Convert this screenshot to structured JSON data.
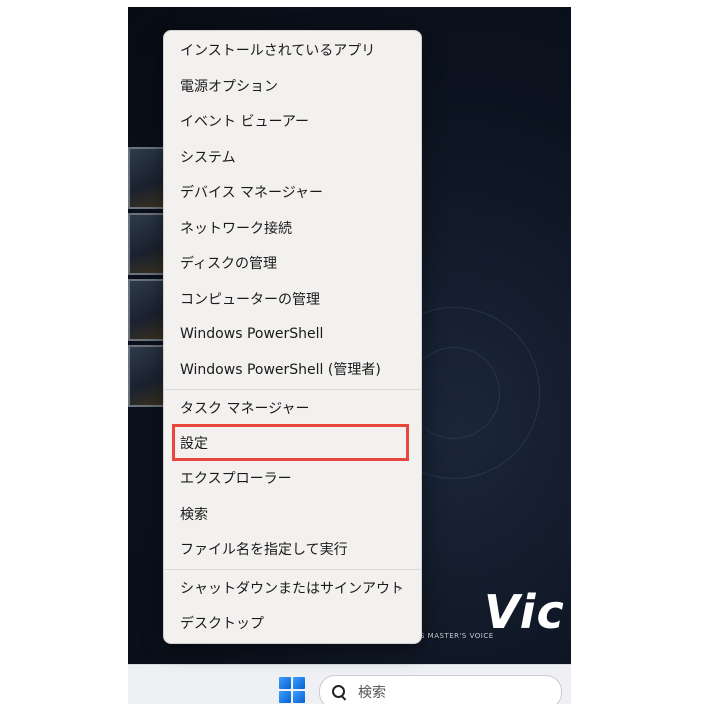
{
  "context_menu": {
    "items": [
      {
        "label": "インストールされているアプリ"
      },
      {
        "label": "電源オプション"
      },
      {
        "label": "イベント ビューアー"
      },
      {
        "label": "システム"
      },
      {
        "label": "デバイス マネージャー"
      },
      {
        "label": "ネットワーク接続"
      },
      {
        "label": "ディスクの管理"
      },
      {
        "label": "コンピューターの管理"
      },
      {
        "label": "Windows PowerShell"
      },
      {
        "label": "Windows PowerShell (管理者)"
      },
      {
        "label": "タスク マネージャー"
      },
      {
        "label": "設定",
        "highlighted": true
      },
      {
        "label": "エクスプローラー"
      },
      {
        "label": "検索"
      },
      {
        "label": "ファイル名を指定して実行"
      },
      {
        "label": "シャットダウンまたはサインアウト",
        "submenu": true
      },
      {
        "label": "デスクトップ"
      }
    ],
    "submenu_glyph": "›",
    "highlight_color": "#e8473b"
  },
  "taskbar": {
    "start_icon": "windows-logo-icon",
    "search_icon": "search-icon",
    "search_placeholder": "検索"
  },
  "wallpaper": {
    "brand_text": "Vic",
    "brand_tagline": "S MASTER'S VOICE"
  }
}
